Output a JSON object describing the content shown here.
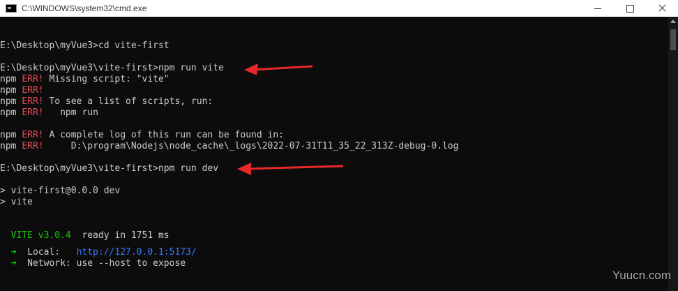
{
  "window": {
    "title": "C:\\WINDOWS\\system32\\cmd.exe",
    "icon": "cmd-icon"
  },
  "console": {
    "lines": [
      {
        "id": "l1",
        "parts": [
          {
            "text": "E:\\Desktop\\myVue3>cd vite-first"
          }
        ]
      },
      {
        "id": "l2",
        "parts": [
          {
            "text": "E:\\Desktop\\myVue3\\vite-first>npm run vite"
          }
        ]
      },
      {
        "id": "l3",
        "parts": [
          {
            "text": "npm "
          },
          {
            "text": "ERR!",
            "style": "err"
          },
          {
            "text": " Missing script: \"vite\""
          }
        ]
      },
      {
        "id": "l4",
        "parts": [
          {
            "text": "npm "
          },
          {
            "text": "ERR!",
            "style": "err"
          }
        ]
      },
      {
        "id": "l5",
        "parts": [
          {
            "text": "npm "
          },
          {
            "text": "ERR!",
            "style": "err"
          },
          {
            "text": " To see a list of scripts, run:"
          }
        ]
      },
      {
        "id": "l6",
        "parts": [
          {
            "text": "npm "
          },
          {
            "text": "ERR!",
            "style": "err"
          },
          {
            "text": "   npm run"
          }
        ]
      },
      {
        "id": "l7",
        "parts": [
          {
            "text": "npm "
          },
          {
            "text": "ERR!",
            "style": "err"
          },
          {
            "text": " A complete log of this run can be found in:"
          }
        ]
      },
      {
        "id": "l8",
        "parts": [
          {
            "text": "npm "
          },
          {
            "text": "ERR!",
            "style": "err"
          },
          {
            "text": "     D:\\program\\Nodejs\\node_cache\\_logs\\2022-07-31T11_35_22_313Z-debug-0.log"
          }
        ]
      },
      {
        "id": "l9",
        "parts": [
          {
            "text": "E:\\Desktop\\myVue3\\vite-first>npm run dev"
          }
        ]
      },
      {
        "id": "l10",
        "parts": [
          {
            "text": "> vite-first@0.0.0 dev"
          }
        ]
      },
      {
        "id": "l11",
        "parts": [
          {
            "text": "> vite"
          }
        ]
      },
      {
        "id": "l12",
        "parts": [
          {
            "text": "  "
          },
          {
            "text": "VITE v3.0.4",
            "style": "green"
          },
          {
            "text": "  ready in 1751 ms"
          }
        ]
      },
      {
        "id": "l13",
        "parts": [
          {
            "text": "  "
          },
          {
            "text": "➜",
            "style": "green"
          },
          {
            "text": "  Local:   "
          },
          {
            "text": "http://127.0.0.1:5173/",
            "style": "blue"
          }
        ]
      },
      {
        "id": "l14",
        "parts": [
          {
            "text": "  "
          },
          {
            "text": "➜",
            "style": "green"
          },
          {
            "text": "  Network: use --host to expose"
          }
        ]
      }
    ]
  },
  "watermark": {
    "text": "Yuucn.com"
  },
  "colors": {
    "background": "#0c0c0c",
    "text": "#cccccc",
    "error": "#e74856",
    "success": "#16c60c",
    "link": "#3b78ff",
    "annotation_arrow": "#e8282b"
  }
}
